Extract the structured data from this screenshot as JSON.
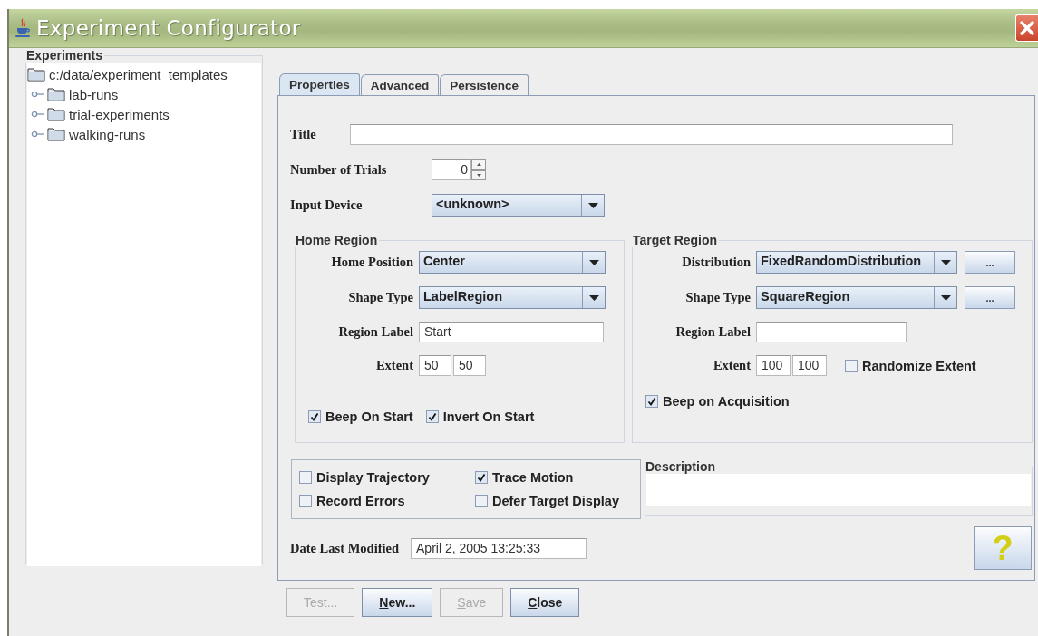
{
  "window": {
    "title": "Experiment Configurator"
  },
  "experiments": {
    "title": "Experiments",
    "tree": [
      {
        "label": "c:/data/experiment_templates",
        "children": [
          {
            "label": "lab-runs",
            "expanded": false
          },
          {
            "label": "trial-experiments",
            "expanded": false
          },
          {
            "label": "walking-runs",
            "expanded": false
          }
        ]
      }
    ]
  },
  "tabs": [
    {
      "label": "Properties",
      "selected": true
    },
    {
      "label": "Advanced",
      "selected": false
    },
    {
      "label": "Persistence",
      "selected": false
    }
  ],
  "properties": {
    "title": {
      "label": "Title"
    },
    "number_of_trials": {
      "label": "Number of Trials",
      "value": "0"
    },
    "input_device": {
      "label": "Input Device",
      "value": "<unknown>"
    },
    "home_region": {
      "title": "Home Region",
      "home_position": {
        "label": "Home Position",
        "value": "Center"
      },
      "shape_type": {
        "label": "Shape Type",
        "value": "LabelRegion"
      },
      "region_label": {
        "label": "Region Label",
        "value": "Start"
      },
      "extent": {
        "label": "Extent",
        "values": [
          "50",
          "50"
        ]
      },
      "checkboxes": [
        {
          "label": "Beep On Start",
          "checked": true
        },
        {
          "label": "Invert On Start",
          "checked": true
        }
      ]
    },
    "target_region": {
      "title": "Target Region",
      "distribution": {
        "label": "Distribution",
        "value": "FixedRandomDistribution",
        "more_button": "..."
      },
      "shape_type": {
        "label": "Shape Type",
        "value": "SquareRegion",
        "more_button": "..."
      },
      "region_label": {
        "label": "Region Label"
      },
      "extent": {
        "label": "Extent",
        "values": [
          "100",
          "100"
        ],
        "checkbox": {
          "label": "Randomize Extent",
          "checked": false
        }
      },
      "checkboxes": [
        {
          "label": "Beep on Acquisition",
          "checked": true
        }
      ]
    },
    "options": [
      {
        "label": "Display Trajectory",
        "checked": false
      },
      {
        "label": "Trace Motion",
        "checked": true
      },
      {
        "label": "Record Errors",
        "checked": false
      },
      {
        "label": "Defer Target Display",
        "checked": false
      }
    ],
    "description": {
      "title": "Description"
    },
    "date_last_modified": {
      "label": "Date Last Modified",
      "value": "April 2, 2005 13:25:33"
    },
    "help_button": {
      "label": "?"
    }
  },
  "buttons": [
    {
      "label": "Test...",
      "disabled": true
    },
    {
      "label": "New...",
      "disabled": false,
      "mnemonic": true
    },
    {
      "label": "Save",
      "disabled": true,
      "mnemonic": true
    },
    {
      "label": "Close",
      "disabled": false,
      "mnemonic": true
    }
  ]
}
